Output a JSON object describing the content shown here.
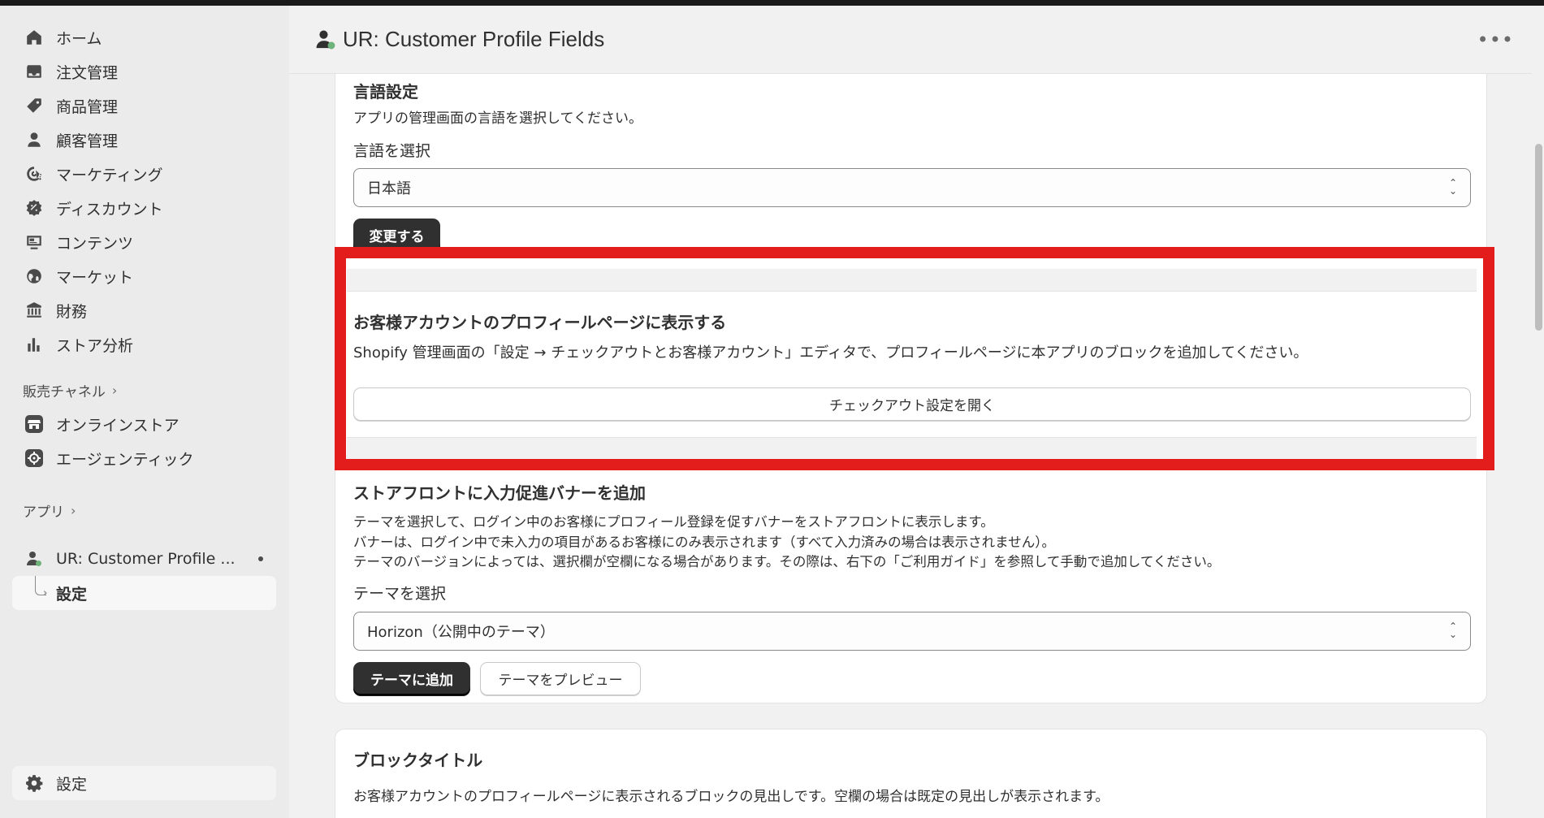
{
  "sidebar": {
    "nav": [
      {
        "label": "ホーム",
        "icon": "home-icon"
      },
      {
        "label": "注文管理",
        "icon": "inbox-icon"
      },
      {
        "label": "商品管理",
        "icon": "tag-icon"
      },
      {
        "label": "顧客管理",
        "icon": "person-icon"
      },
      {
        "label": "マーケティング",
        "icon": "target-icon"
      },
      {
        "label": "ディスカウント",
        "icon": "discount-icon"
      },
      {
        "label": "コンテンツ",
        "icon": "content-icon"
      },
      {
        "label": "マーケット",
        "icon": "globe-icon"
      },
      {
        "label": "財務",
        "icon": "bank-icon"
      },
      {
        "label": "ストア分析",
        "icon": "chart-icon"
      }
    ],
    "sales_channels_label": "販売チャネル",
    "sales_channels": [
      {
        "label": "オンラインストア",
        "icon": "store-icon"
      },
      {
        "label": "エージェンティック",
        "icon": "agentic-icon"
      }
    ],
    "apps_label": "アプリ",
    "app_name": "UR: Customer Profile ...",
    "app_sub_label": "設定",
    "settings_label": "設定"
  },
  "header": {
    "title": "UR: Customer Profile Fields",
    "more": "•••"
  },
  "language_section": {
    "title": "言語設定",
    "description": "アプリの管理画面の言語を選択してください。",
    "select_label": "言語を選択",
    "select_value": "日本語",
    "button": "変更する"
  },
  "profile_section": {
    "title": "お客様アカウントのプロフィールページに表示する",
    "description": "Shopify 管理画面の「設定 → チェックアウトとお客様アカウント」エディタで、プロフィールページに本アプリのブロックを追加してください。",
    "button": "チェックアウト設定を開く"
  },
  "banner_section": {
    "title": "ストアフロントに入力促進バナーを追加",
    "lines": [
      "テーマを選択して、ログイン中のお客様にプロフィール登録を促すバナーをストアフロントに表示します。",
      "バナーは、ログイン中で未入力の項目があるお客様にのみ表示されます（すべて入力済みの場合は表示されません）。",
      "テーマのバージョンによっては、選択欄が空欄になる場合があります。その際は、右下の「ご利用ガイド」を参照して手動で追加してください。"
    ],
    "select_label": "テーマを選択",
    "select_value": "Horizon（公開中のテーマ）",
    "add_button": "テーマに追加",
    "preview_button": "テーマをプレビュー"
  },
  "block_title_section": {
    "title": "ブロックタイトル",
    "description": "お客様アカウントのプロフィールページに表示されるブロックの見出しです。空欄の場合は既定の見出しが表示されます。"
  },
  "colors": {
    "highlight": "#e31c1c",
    "primary_button": "#303030"
  }
}
